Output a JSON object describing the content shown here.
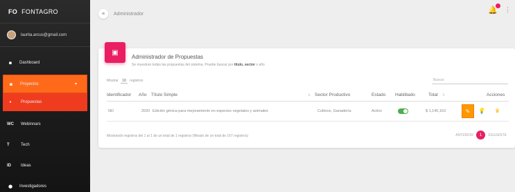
{
  "sidebar": {
    "brand_abbr": "FO",
    "brand_name": "FONTAGRO",
    "user_email": "laurita.arcus@gmail.com",
    "items": [
      {
        "abbr": "",
        "icon": "dashboard-icon",
        "glyph": "▪",
        "label": "Dashboard"
      },
      {
        "abbr": "",
        "icon": "folder-icon",
        "glyph": "▪",
        "label": "Proyectos"
      },
      {
        "abbr": "",
        "icon": "dot-icon",
        "glyph": "•",
        "label": "Propuestas"
      },
      {
        "abbr": "WC",
        "icon": "",
        "glyph": "",
        "label": "Webinnars"
      },
      {
        "abbr": "T",
        "icon": "",
        "glyph": "",
        "label": "Tech"
      },
      {
        "abbr": "ID",
        "icon": "",
        "glyph": "",
        "label": "Ideas"
      },
      {
        "abbr": "",
        "icon": "account-circle-icon",
        "glyph": "●",
        "label": "Investigadores"
      }
    ]
  },
  "topbar": {
    "menu_glyph": "≡",
    "title": "Administrador"
  },
  "card": {
    "icon_glyph": "▣",
    "title": "Administrador de Propuestas",
    "subtitle_prefix": "Se muestran todas las propuestas del sistema. Pruebe buscar por",
    "subtitle_bold": "título, sector",
    "subtitle_suffix": "o año",
    "show_prefix": "Mostrar",
    "show_value": "10",
    "show_suffix": "registros",
    "search_placeholder": "Buscar"
  },
  "table": {
    "headers": [
      "Identificador",
      "Año",
      "Título Simple",
      "Sector Productivo",
      "Estado",
      "Habilitado",
      "Total",
      "Acciones"
    ],
    "rows": [
      {
        "id": "ND",
        "year": "2020",
        "title": "Edición génica para mejoramiento en especies vegetales y animales",
        "sector": "Cultivos, Ganadería",
        "status": "Activo",
        "enabled": true,
        "total": "$ 1,140,163"
      }
    ]
  },
  "footer": {
    "info": "Mostrando registros del 1 al 1 de un total de 1 registros (filtrado de un total de 167 registros)",
    "prev": "ANTERIOR",
    "page": "1",
    "next": "SIGUIENTE"
  },
  "colors": {
    "accent_pink": "#e91e63",
    "active_orange": "#ff6a1a",
    "toggle_green": "#4caf50",
    "edit_orange": "#ff9800"
  }
}
